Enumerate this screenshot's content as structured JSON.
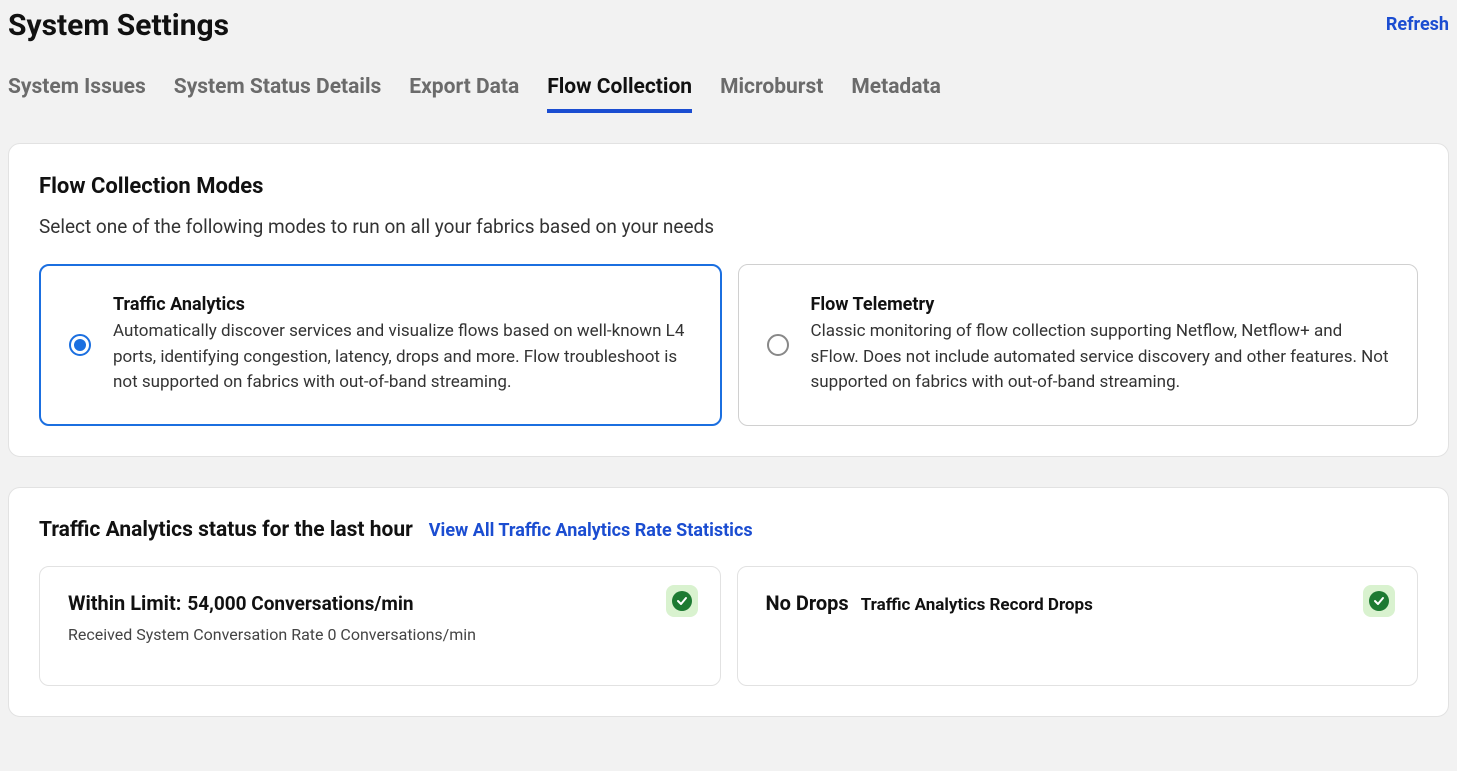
{
  "header": {
    "title": "System Settings",
    "refresh": "Refresh"
  },
  "tabs": [
    {
      "label": "System Issues",
      "active": false
    },
    {
      "label": "System Status Details",
      "active": false
    },
    {
      "label": "Export Data",
      "active": false
    },
    {
      "label": "Flow Collection",
      "active": true
    },
    {
      "label": "Microburst",
      "active": false
    },
    {
      "label": "Metadata",
      "active": false
    }
  ],
  "modes": {
    "title": "Flow Collection Modes",
    "desc": "Select one of the following modes to run on all your fabrics based on your needs",
    "options": [
      {
        "title": "Traffic Analytics",
        "desc": "Automatically discover services and visualize flows based on well-known L4 ports, identifying congestion, latency, drops and more. Flow troubleshoot is not supported on fabrics with out-of-band streaming.",
        "selected": true
      },
      {
        "title": "Flow Telemetry",
        "desc": "Classic monitoring of flow collection supporting Netflow, Netflow+ and sFlow. Does not include automated service discovery and other features. Not supported on fabrics with out-of-band streaming.",
        "selected": false
      }
    ]
  },
  "status": {
    "title": "Traffic Analytics status for the last hour",
    "link": "View All Traffic Analytics Rate Statistics",
    "cards": [
      {
        "label": "Within Limit:",
        "value": "54,000 Conversations/min",
        "sub": "Received System Conversation Rate  0 Conversations/min",
        "ok": true
      },
      {
        "label": "No Drops",
        "value": "",
        "subLabel": "Traffic Analytics Record Drops",
        "sub": "",
        "ok": true
      }
    ]
  }
}
